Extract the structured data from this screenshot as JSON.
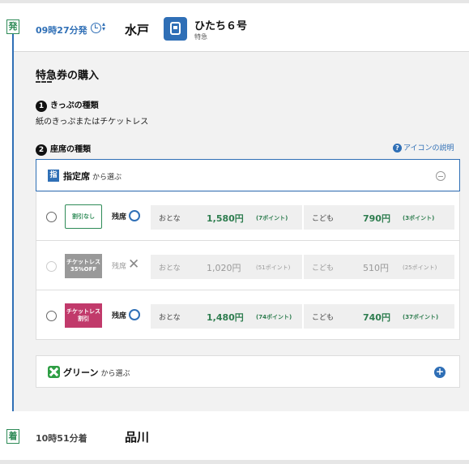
{
  "departure": {
    "badge": "発",
    "time": "09時27分発",
    "station": "水戸",
    "train_name": "ひたち６号",
    "train_type": "特急"
  },
  "purchase": {
    "title": "特急券の購入",
    "step1_num": "1",
    "step1_label": "きっぷの種類",
    "step1_value": "紙のきっぷまたはチケットレス",
    "step2_num": "2",
    "step2_label": "座席の種類",
    "help_link": "アイコンの説明",
    "help_icon": "question-circle-icon"
  },
  "reserved": {
    "icon_char": "指",
    "label": "指定席",
    "sub": "から選ぶ"
  },
  "fare_rows": [
    {
      "tag_line1": "割引なし",
      "tag_line2": "",
      "tag_style": "plain",
      "availability_label": "残席",
      "availability_mark": "circle",
      "enabled": true,
      "adult_label": "おとな",
      "adult_price": "1,580円",
      "adult_points": "(7ポイント)",
      "child_label": "こども",
      "child_price": "790円",
      "child_points": "(3ポイント)"
    },
    {
      "tag_line1": "チケットレス",
      "tag_line2": "35%OFF",
      "tag_style": "grey",
      "availability_label": "残席",
      "availability_mark": "cross",
      "enabled": false,
      "adult_label": "おとな",
      "adult_price": "1,020円",
      "adult_points": "(51ポイント)",
      "child_label": "こども",
      "child_price": "510円",
      "child_points": "(25ポイント)"
    },
    {
      "tag_line1": "チケットレス",
      "tag_line2": "割引",
      "tag_style": "pink",
      "availability_label": "残席",
      "availability_mark": "circle",
      "enabled": true,
      "adult_label": "おとな",
      "adult_price": "1,480円",
      "adult_points": "(74ポイント)",
      "child_label": "こども",
      "child_price": "740円",
      "child_points": "(37ポイント)"
    }
  ],
  "green": {
    "label": "グリーン",
    "sub": "から選ぶ"
  },
  "arrival": {
    "badge": "着",
    "time": "10時51分着",
    "station": "品川"
  },
  "colors": {
    "accent": "#2f6fb6",
    "price_green": "#2e7d4f",
    "badge_green": "#2e8b57",
    "pink_tag": "#c13a6b"
  }
}
